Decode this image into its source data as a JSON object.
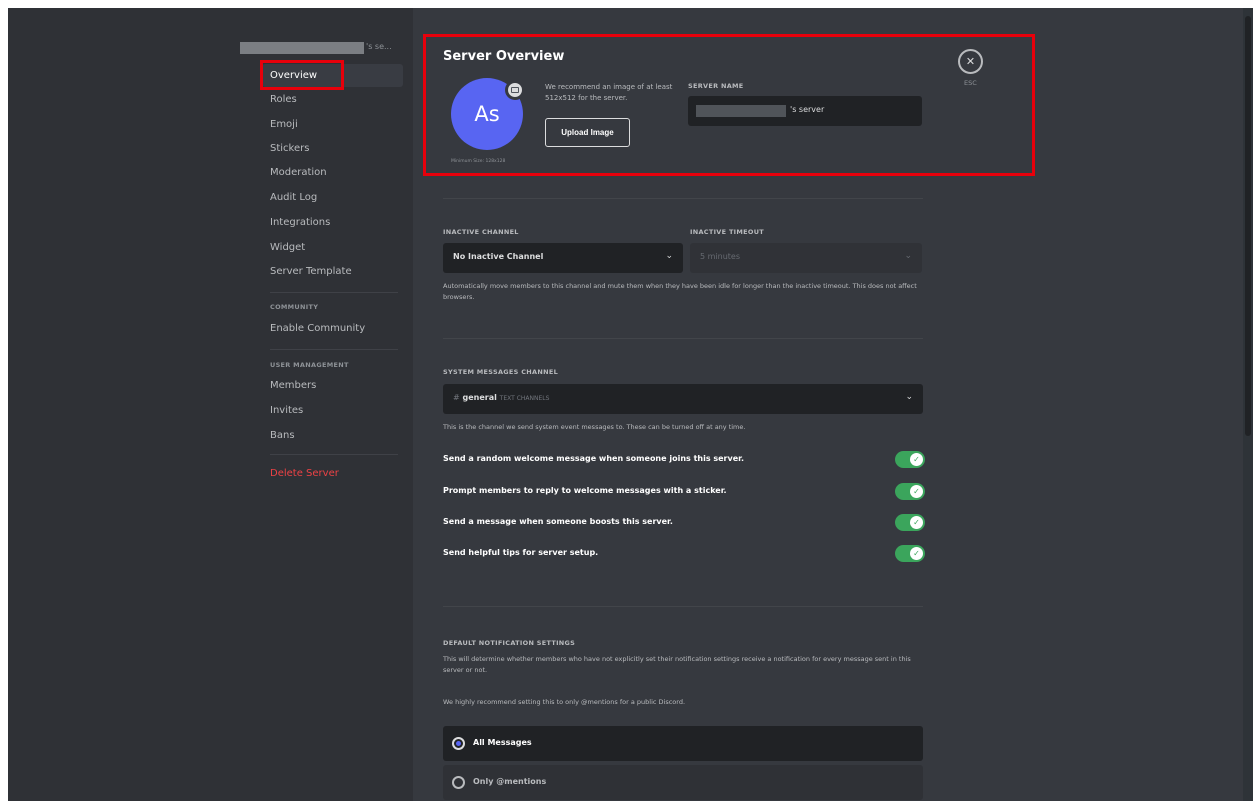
{
  "sidebar": {
    "server_title_suffix": "'s se...",
    "items": [
      {
        "label": "Overview"
      },
      {
        "label": "Roles"
      },
      {
        "label": "Emoji"
      },
      {
        "label": "Stickers"
      },
      {
        "label": "Moderation"
      },
      {
        "label": "Audit Log"
      },
      {
        "label": "Integrations"
      },
      {
        "label": "Widget"
      },
      {
        "label": "Server Template"
      }
    ],
    "community_heading": "COMMUNITY",
    "community_items": [
      {
        "label": "Enable Community"
      }
    ],
    "user_mgmt_heading": "USER MANAGEMENT",
    "user_mgmt_items": [
      {
        "label": "Members"
      },
      {
        "label": "Invites"
      },
      {
        "label": "Bans"
      }
    ],
    "delete_label": "Delete Server"
  },
  "overview": {
    "title": "Server Overview",
    "avatar_initials": "As",
    "min_size": "Minimum Size: 128x128",
    "recommend_text": "We recommend an image of at least 512x512 for the server.",
    "upload_label": "Upload Image",
    "server_name_label": "SERVER NAME",
    "server_name_value": "'s server",
    "esc_label": "ESC",
    "close_glyph": "✕"
  },
  "inactive": {
    "channel_label": "INACTIVE CHANNEL",
    "channel_value": "No Inactive Channel",
    "timeout_label": "INACTIVE TIMEOUT",
    "timeout_value": "5 minutes",
    "help": "Automatically move members to this channel and mute them when they have been idle for longer than the inactive timeout. This does not affect browsers."
  },
  "system": {
    "label": "SYSTEM MESSAGES CHANNEL",
    "hash": "#",
    "channel": "general",
    "category": "TEXT CHANNELS",
    "help": "This is the channel we send system event messages to. These can be turned off at any time.",
    "toggles": [
      {
        "label": "Send a random welcome message when someone joins this server.",
        "on": true
      },
      {
        "label": "Prompt members to reply to welcome messages with a sticker.",
        "on": true
      },
      {
        "label": "Send a message when someone boosts this server.",
        "on": true
      },
      {
        "label": "Send helpful tips for server setup.",
        "on": true
      }
    ]
  },
  "notifications": {
    "label": "DEFAULT NOTIFICATION SETTINGS",
    "help": "This will determine whether members who have not explicitly set their notification settings receive a notification for every message sent in this server or not.",
    "recommend": "We highly recommend setting this to only @mentions for a public Discord.",
    "options": [
      {
        "label": "All Messages",
        "selected": true
      },
      {
        "label": "Only @mentions",
        "selected": false
      }
    ]
  },
  "colors": {
    "accent": "#5865f2",
    "toggle_on": "#3ba55c",
    "danger": "#ed4245",
    "highlight": "#e8000b"
  }
}
